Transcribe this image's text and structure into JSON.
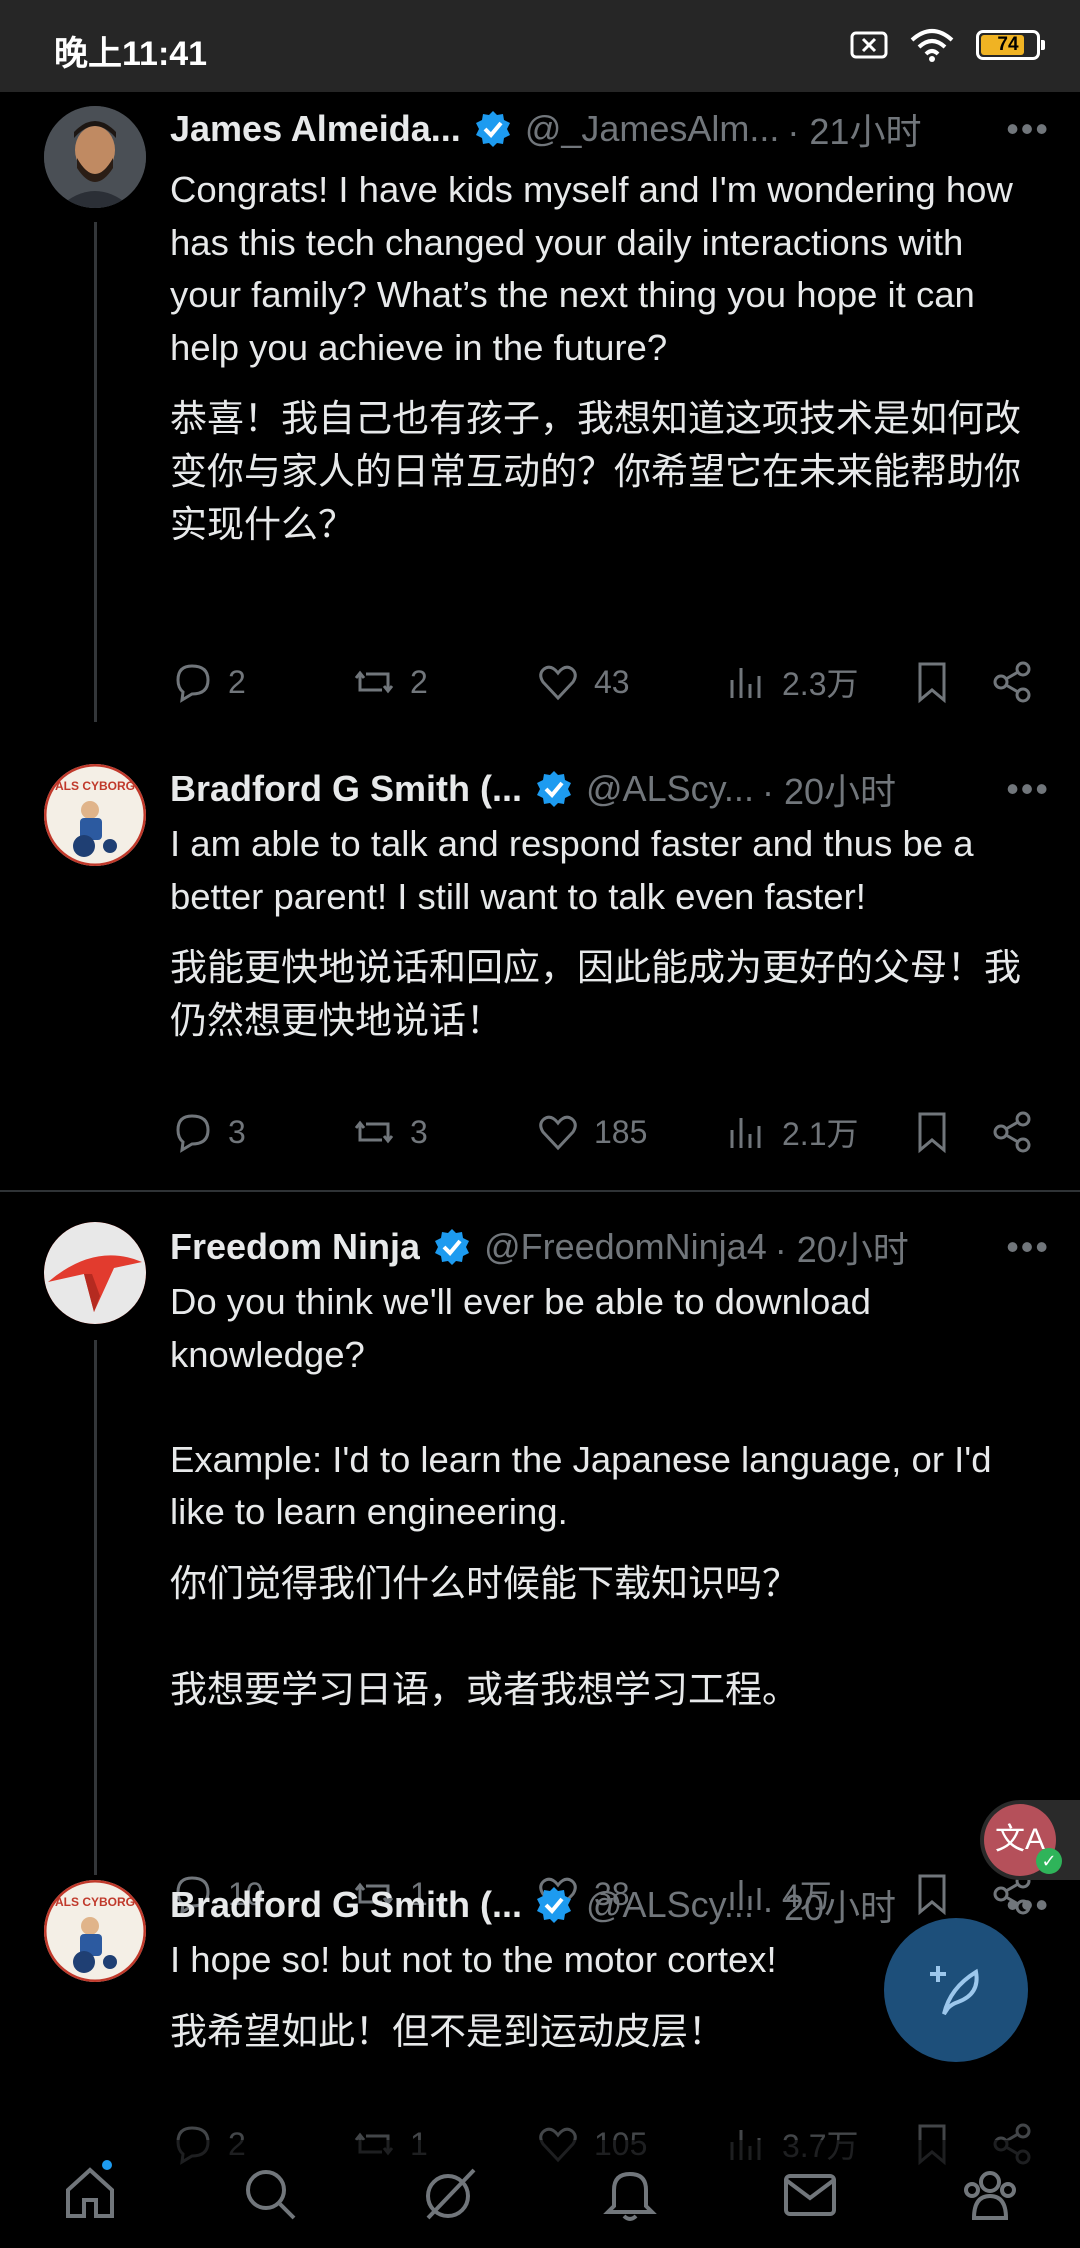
{
  "status_bar": {
    "time": "晚上11:41",
    "battery": "74"
  },
  "tweets": [
    {
      "name": "James Almeida...",
      "handle": "@_JamesAlm...",
      "time": "· 21小时",
      "text_en": "Congrats! I have kids myself and I'm wondering how has this tech changed your daily interactions with your family? What’s the next thing you hope it can help you achieve in the future?",
      "text_zh": "恭喜！我自己也有孩子，我想知道这项技术是如何改变你与家人的日常互动的？你希望它在未来能帮助你实现什么？",
      "replies": "2",
      "reposts": "2",
      "likes": "43",
      "views": "2.3万"
    },
    {
      "name": "Bradford G Smith (...",
      "handle": "@ALScy...",
      "time": "· 20小时",
      "text_en": "I am able to talk and respond faster and thus be a better parent!  I still want to talk even faster!",
      "text_zh": "我能更快地说话和回应，因此能成为更好的父母！我仍然想更快地说话！",
      "replies": "3",
      "reposts": "3",
      "likes": "185",
      "views": "2.1万"
    },
    {
      "name": "Freedom Ninja",
      "handle": "@FreedomNinja4",
      "time": "· 20小时",
      "text_en": "Do you think we'll ever be able to download knowledge?\n\nExample: I'd to learn the Japanese language, or I'd like to learn engineering.",
      "text_zh": "你们觉得我们什么时候能下载知识吗？\n\n我想要学习日语，或者我想学习工程。",
      "replies": "10",
      "reposts": "1",
      "likes": "38",
      "views": "4万"
    },
    {
      "name": "Bradford G Smith (...",
      "handle": "@ALScy...",
      "time": "· 20小时",
      "text_en": "I hope so!  but not to the motor cortex!",
      "text_zh": "我希望如此！但不是到运动皮层！",
      "replies": "2",
      "reposts": "1",
      "likes": "105",
      "views": "3.7万"
    }
  ],
  "avatars": {
    "cyborg_label": "ALS CYBORG"
  },
  "colors": {
    "background": "#000000",
    "accent": "#1d9bf0",
    "muted": "#71767b",
    "text": "#e7e9ea"
  },
  "bottom_nav": [
    "home-icon",
    "search-icon",
    "grok-icon",
    "notifications-icon",
    "messages-icon",
    "communities-icon"
  ]
}
